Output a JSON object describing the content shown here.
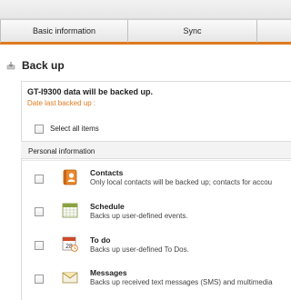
{
  "tabs": {
    "basic_information": "Basic information",
    "sync": "Sync"
  },
  "header": {
    "title": "Back up"
  },
  "panel": {
    "device_text": "GT-I9300 data will be backed up.",
    "date_text": "Date last backed up :",
    "select_all_label": "Select all items"
  },
  "section": {
    "label": "Personal information"
  },
  "items": [
    {
      "name": "Contacts",
      "description": "Only local contacts will be backed up; contacts for accou",
      "icon": "contacts-icon"
    },
    {
      "name": "Schedule",
      "description": "Backs up user-defined events.",
      "icon": "calendar-icon"
    },
    {
      "name": "To do",
      "description": "Backs up user-defined To Dos.",
      "icon": "todo-calendar-icon"
    },
    {
      "name": "Messages",
      "description": "Backs up received text messages (SMS) and multimedia",
      "icon": "envelope-icon"
    }
  ],
  "colors": {
    "accent": "#e07a1f"
  }
}
